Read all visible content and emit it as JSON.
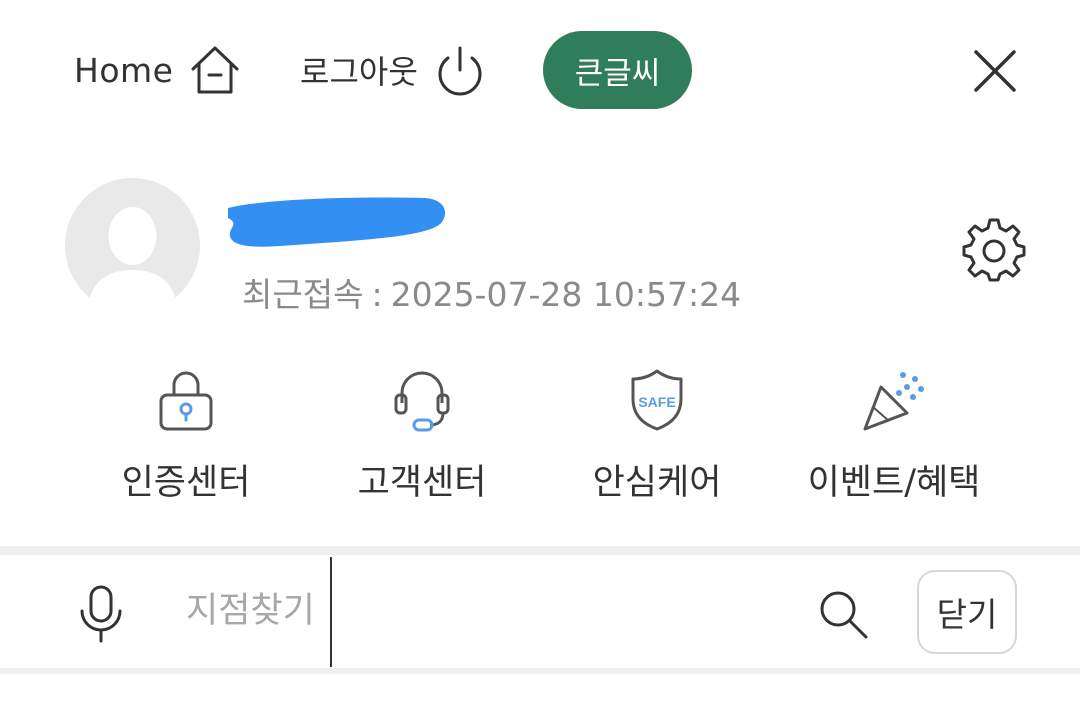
{
  "topbar": {
    "home_label": "Home",
    "logout_label": "로그아웃",
    "bigfont_label": "큰글씨"
  },
  "profile": {
    "last_access_label": "최근접속",
    "last_access_separator": ":",
    "last_access_value": "2025-07-28 10:57:24"
  },
  "quick_menu": [
    {
      "label": "인증센터",
      "icon": "lock-icon"
    },
    {
      "label": "고객센터",
      "icon": "headset-icon"
    },
    {
      "label": "안심케어",
      "icon": "safe-shield-icon",
      "badge_text": "SAFE"
    },
    {
      "label": "이벤트/혜택",
      "icon": "party-popper-icon"
    }
  ],
  "search": {
    "placeholder": "지점찾기",
    "value": "",
    "close_label": "닫기"
  },
  "colors": {
    "accent": "#2f7d5b",
    "redaction": "#3390f2",
    "icon_blue": "#5b9be8",
    "icon_gray": "#555555",
    "muted_text": "#8a8a8a"
  }
}
